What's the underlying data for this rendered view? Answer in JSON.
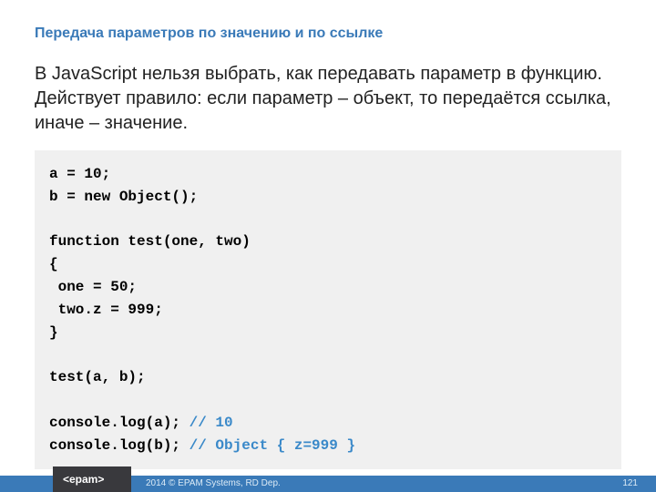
{
  "title": "Передача параметров по значению и по ссылке",
  "body": "В JavaScript нельзя выбрать, как передавать параметр в функцию. Действует правило: если параметр – объект, то передаётся ссылка, иначе – значение.",
  "code": {
    "l1": "a = 10;",
    "l2": "b = new Object();",
    "l3": "function test(one, two)",
    "l4": "{",
    "l5": " one = 50;",
    "l6": " two.z = 999;",
    "l7": "}",
    "l8": "test(a, b);",
    "l9": "console.log(a); ",
    "c9": "// 10",
    "l10": "console.log(b); ",
    "c10": "// Object { z=999 }"
  },
  "footer": {
    "copyright": "2014 © EPAM Systems, RD Dep.",
    "page": "121"
  }
}
